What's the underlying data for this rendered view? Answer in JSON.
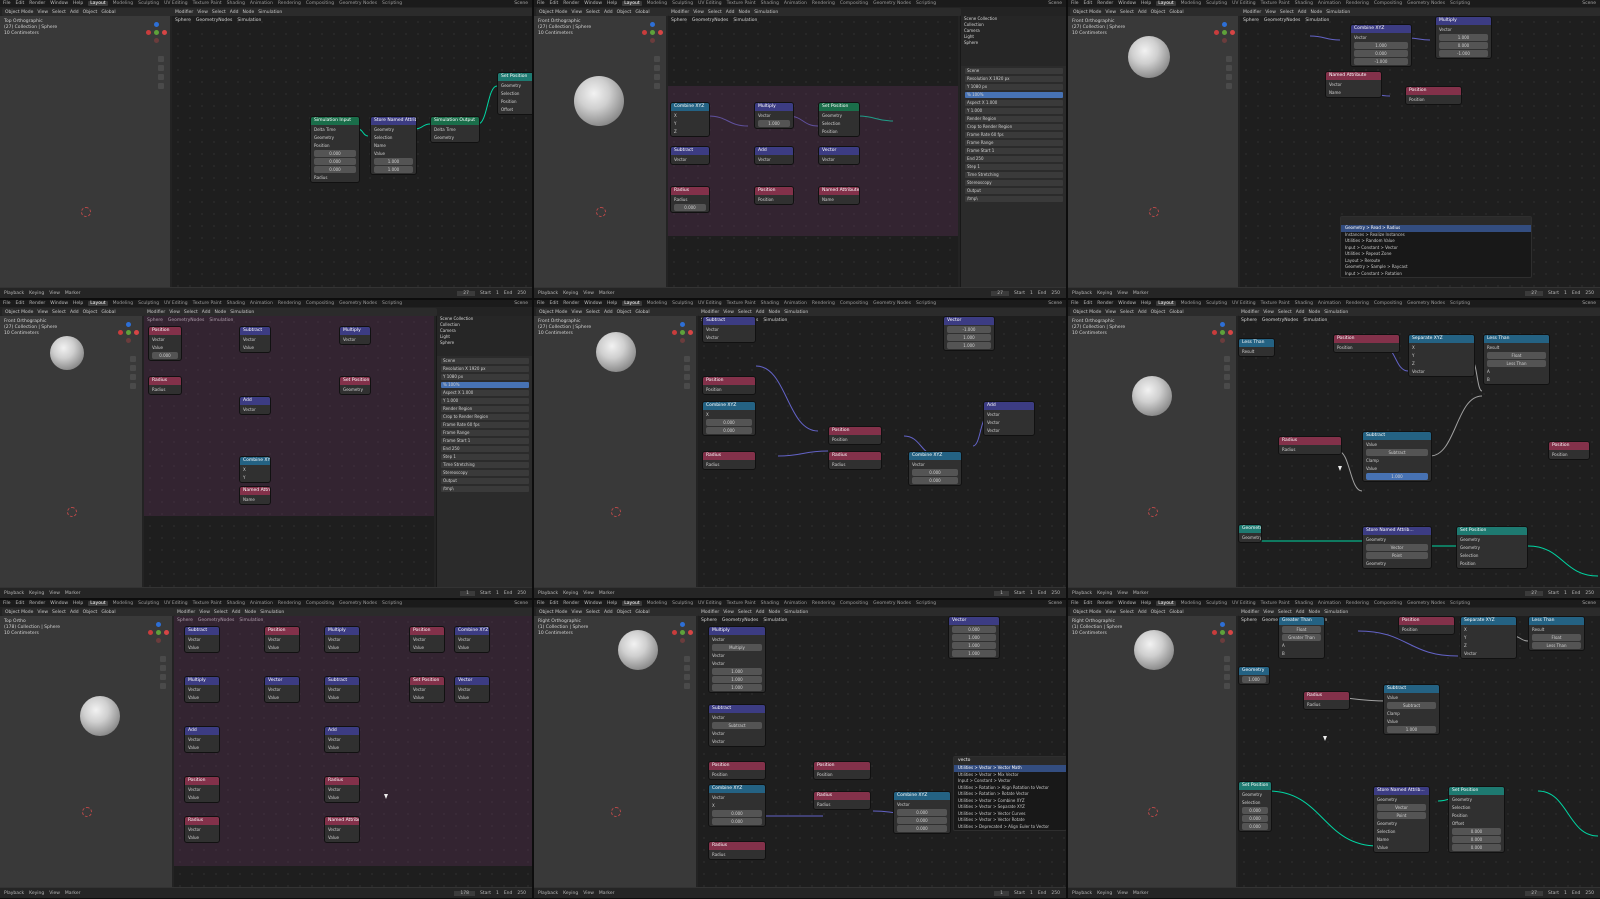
{
  "menu": [
    "File",
    "Edit",
    "Render",
    "Window",
    "Help"
  ],
  "workspace_tabs": [
    "Layout",
    "Modeling",
    "Sculpting",
    "UV Editing",
    "Texture Paint",
    "Shading",
    "Animation",
    "Rendering",
    "Compositing",
    "Geometry Nodes",
    "Scripting"
  ],
  "scene_label": "Scene",
  "viewlayer_label": "ViewLayer",
  "header_left": [
    "Object Mode",
    "View",
    "Select",
    "Add",
    "Object",
    "Global"
  ],
  "header_node": [
    "Modifier",
    "View",
    "Select",
    "Add",
    "Node",
    "Simulation"
  ],
  "breadcrumb": [
    "Sphere",
    "GeometryNodes",
    "Simulation"
  ],
  "viewport_info_a": {
    "view": "Top Orthographic",
    "collection": "(27) Collection | Sphere",
    "units": "10 Centimeters"
  },
  "viewport_info_b": {
    "view": "Front Orthographic",
    "collection": "(27) Collection | Sphere",
    "units": "10 Centimeters"
  },
  "viewport_info_c": {
    "view": "Right Orthographic",
    "collection": "(1) Collection | Sphere",
    "units": "10 Centimeters"
  },
  "viewport_info_d": {
    "view": "Top Ortho",
    "collection": "(178) Collection | Sphere",
    "units": "10 Centimeters"
  },
  "timeline": {
    "items": [
      "Playback",
      "Keying",
      "View",
      "Marker"
    ],
    "frame": "27",
    "start_label": "Start",
    "start": "1",
    "end_label": "End",
    "end": "250"
  },
  "timeline_b": {
    "frame": "1",
    "start": "1",
    "end": "250"
  },
  "timeline_c": {
    "frame": "178",
    "start": "1",
    "end": "250"
  },
  "outliner": {
    "title": "Scene Collection",
    "rows": [
      "Collection",
      "Camera",
      "Light",
      "Sphere"
    ]
  },
  "properties": {
    "title": "Scene",
    "rows": [
      "Resolution X  1920 px",
      "Y  1080 px",
      "%  100%",
      "Aspect X  1.000",
      "Y  1.000",
      "Render Region",
      "Crop to Render Region",
      "Frame Rate  60 fps",
      "Frame Range",
      "Frame Start  1",
      "End  250",
      "Step  1",
      "Time Stretching",
      "Stereoscopy",
      "Output",
      "/tmp\\"
    ]
  },
  "nodes": {
    "position": "Position",
    "radius": "Radius",
    "combine_xyz": "Combine XYZ",
    "separate_xyz": "Separate XYZ",
    "less_than": "Less Than",
    "greater_than": "Greater Than",
    "subtract": "Subtract",
    "add": "Add",
    "multiply": "Multiply",
    "store_named_attribute": "Store Named Attrib...",
    "set_position": "Set Position",
    "named_attribute": "Named Attribute",
    "simulation_output": "Simulation Output",
    "simulation_input": "Simulation Input",
    "vector": "Vector",
    "value": "Value",
    "geometry": "Geometry",
    "selection": "Selection",
    "offset": "Offset",
    "clamp": "Clamp",
    "result": "Result",
    "float": "Float",
    "point": "Point",
    "name": "Name",
    "velocity": "Velocity",
    "delta_time": "Delta Time",
    "a": "A",
    "b": "B",
    "x": "X",
    "y": "Y",
    "z": "Z"
  },
  "values": {
    "zero": "0.000",
    "one": "1.000",
    "neg_one": "-1.000",
    "value_sub": "1.000",
    "value_sub2": "1.000"
  },
  "search_menu_a": {
    "query": "",
    "items": [
      "Geometry > Read > Radius",
      "Instances > Realize Instances",
      "Utilities > Random Value",
      "Input > Constant > Vector",
      "Utilities > Repeat Zone",
      "Layout > Reroute",
      "Geometry > Sample > Raycast",
      "Input > Constant > Rotation"
    ]
  },
  "search_menu_b": {
    "query": "vecto",
    "items": [
      "Utilities > Vector > Vector Math",
      "Utilities > Vector > Mix Vector",
      "Input > Constant > Vector",
      "Utilities > Rotation > Align Rotation to Vector",
      "Utilities > Rotation > Rotate Vector",
      "Utilities > Vector > Combine XYZ",
      "Utilities > Vector > Separate XYZ",
      "Utilities > Vector > Vector Curves",
      "Utilities > Vector > Vector Rotate",
      "Utilities > Deprecated > Align Euler to Vector"
    ]
  },
  "status_text": "Collection | Sphere | Verts:482 | Faces:480 | Tris:960 | Objects:1/3",
  "colors": {
    "geometry_wire": "#00d6a3",
    "vector_wire": "#6363c7",
    "float_wire": "#a1a1a1",
    "sim_zone": "#5c3056",
    "accent": "#4772b3"
  }
}
